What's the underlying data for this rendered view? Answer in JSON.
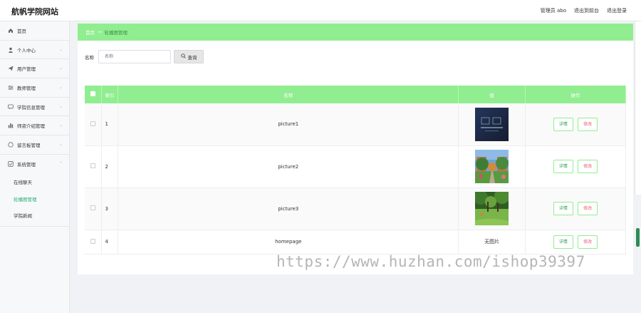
{
  "header": {
    "logo": "航帆学院网站",
    "admin": "管理员 abo",
    "to_front": "退出到前台",
    "logout": "退出登录"
  },
  "sidebar": {
    "items": [
      {
        "label": "首页",
        "icon": "home-icon"
      },
      {
        "label": "个人中心",
        "icon": "user-icon"
      },
      {
        "label": "用户管理",
        "icon": "send-icon"
      },
      {
        "label": "教师管理",
        "icon": "sliders-icon"
      },
      {
        "label": "学院信息管理",
        "icon": "chat-icon"
      },
      {
        "label": "师资介绍管理",
        "icon": "chart-icon"
      },
      {
        "label": "留言板管理",
        "icon": "circle-icon"
      },
      {
        "label": "系统管理",
        "icon": "checkbox-icon"
      }
    ],
    "sub_items": [
      {
        "label": "在线聊天",
        "active": false
      },
      {
        "label": "轮播图管理",
        "active": true
      },
      {
        "label": "学院新闻",
        "active": false
      }
    ]
  },
  "breadcrumb": {
    "home": "首页",
    "separator": "→",
    "current": "轮播图管理"
  },
  "search": {
    "label": "名称",
    "placeholder": "名称",
    "button": "查询"
  },
  "table": {
    "headers": [
      "",
      "索引",
      "名称",
      "值",
      "操作"
    ],
    "rows": [
      {
        "index": "1",
        "name": "picture1",
        "image": "dark-poster"
      },
      {
        "index": "2",
        "name": "picture2",
        "image": "campus-garden"
      },
      {
        "index": "3",
        "name": "picture3",
        "image": "park-lawn"
      },
      {
        "index": "4",
        "name": "homepage",
        "no_image": "无图片"
      }
    ],
    "detail_label": "详情",
    "edit_label": "修改"
  },
  "watermark": "https://www.huzhan.com/ishop39397",
  "colors": {
    "accent": "#90ee90",
    "active_text": "#25b07a",
    "edit_text": "#e8607a"
  }
}
